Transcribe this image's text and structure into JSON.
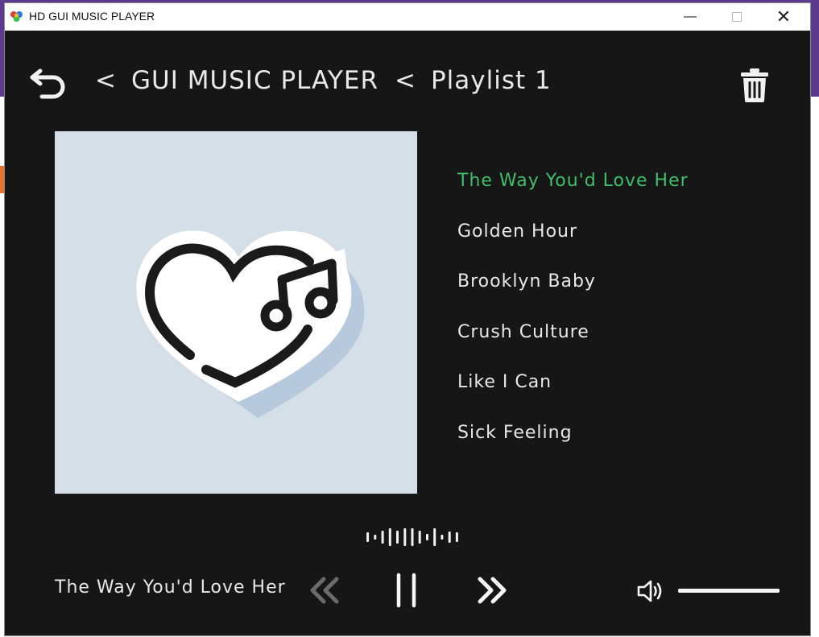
{
  "window": {
    "title": "HD GUI MUSIC PLAYER",
    "minimize_label": "—",
    "close_label": "✕"
  },
  "header": {
    "separator": "<",
    "breadcrumb": [
      "GUI MUSIC PLAYER",
      "Playlist 1"
    ],
    "back_icon": "undo-arrow-icon",
    "delete_icon": "trash-icon"
  },
  "album_art": {
    "icon": "heart-music-note-icon",
    "background_color": "#d4dfe8"
  },
  "playlist": {
    "songs": [
      {
        "title": "The Way You'd Love Her",
        "active": true
      },
      {
        "title": "Golden Hour",
        "active": false
      },
      {
        "title": "Brooklyn Baby",
        "active": false
      },
      {
        "title": "Crush Culture",
        "active": false
      },
      {
        "title": "Like I Can",
        "active": false
      },
      {
        "title": "Sick Feeling",
        "active": false
      }
    ],
    "active_color": "#3fbf6a",
    "text_color": "#e8e8e8"
  },
  "player": {
    "now_playing": "The Way You'd Love Her",
    "state": "playing",
    "prev_icon": "double-chevron-left-icon",
    "pause_icon": "pause-icon",
    "next_icon": "double-chevron-right-icon",
    "volume_icon": "speaker-volume-icon",
    "volume_level": 1.0,
    "visualizer_icon": "audio-waveform-icon"
  },
  "colors": {
    "window_background": "#161616",
    "text": "#e8e8e8",
    "accent": "#3fbf6a",
    "disabled": "#6b6b6b"
  }
}
